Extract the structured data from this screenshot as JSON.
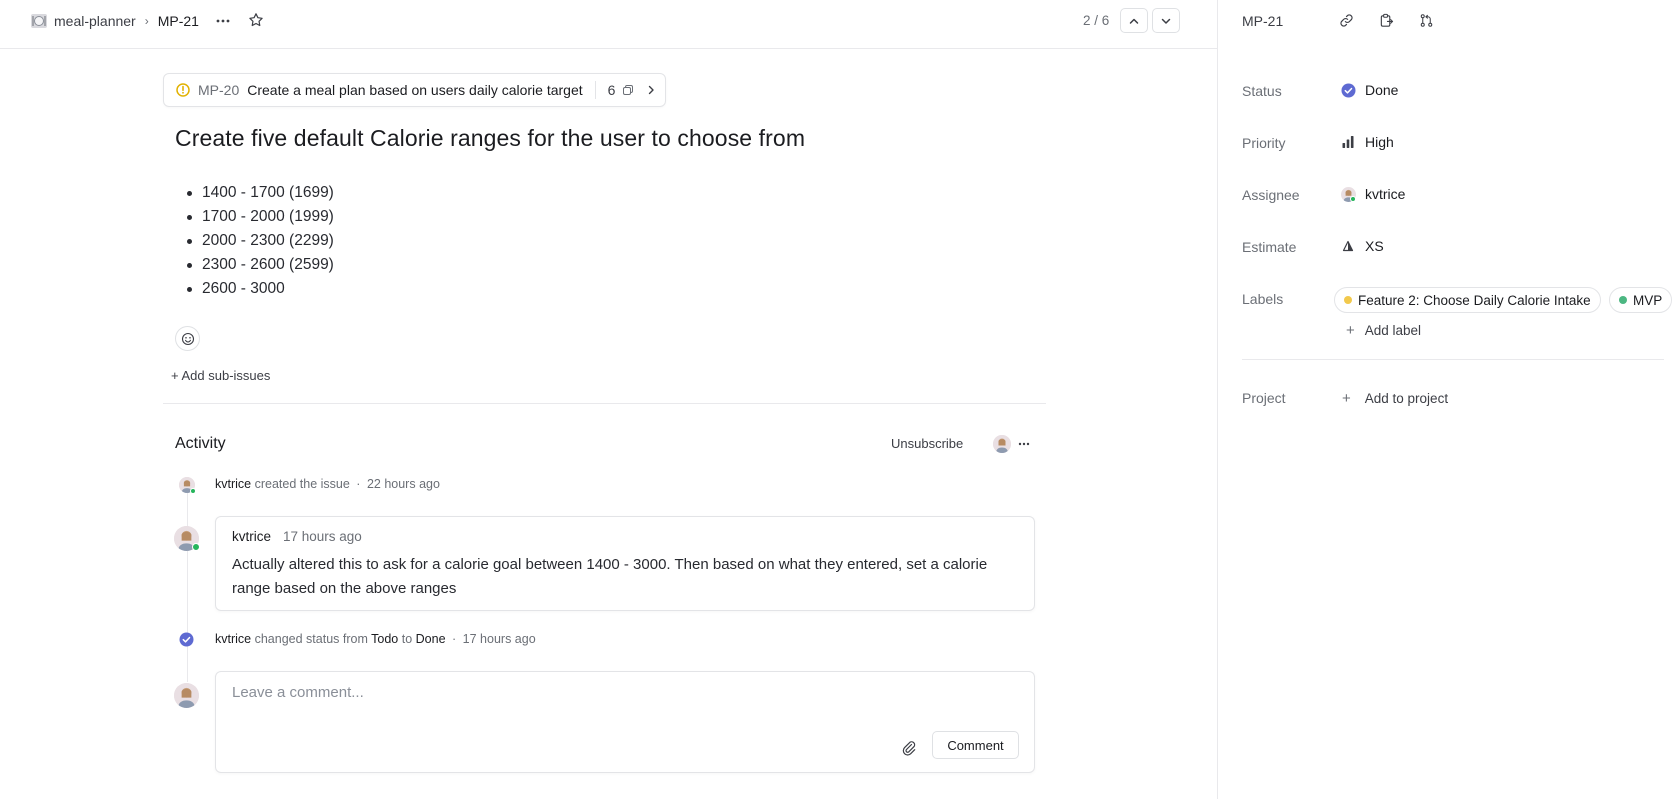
{
  "breadcrumb": {
    "project": "meal-planner",
    "separator": "›",
    "issue": "MP-21"
  },
  "pager": {
    "current": "2",
    "total": "6",
    "text": "2 / 6"
  },
  "parent_issue": {
    "id": "MP-20",
    "title": "Create a meal plan based on users daily calorie target",
    "sub_count": "6"
  },
  "issue": {
    "title": "Create five default Calorie ranges for the user to choose from",
    "description_items": [
      "1400 - 1700 (1699)",
      "1700 - 2000 (1999)",
      "2000 - 2300 (2299)",
      "2300 - 2600 (2599)",
      "2600 - 3000"
    ],
    "add_sub_issues": "+ Add sub-issues"
  },
  "activity": {
    "title": "Activity",
    "unsubscribe": "Unsubscribe",
    "events": [
      {
        "user": "kvtrice",
        "action": "created the issue",
        "dot": "·",
        "time": "22 hours ago"
      },
      {
        "user": "kvtrice",
        "action": "changed status from",
        "from": "Todo",
        "to_word": "to",
        "to": "Done",
        "dot": "·",
        "time": "17 hours ago"
      }
    ],
    "comment": {
      "user": "kvtrice",
      "time": "17 hours ago",
      "body": "Actually altered this to ask for a calorie goal between 1400 - 3000. Then based on what they entered, set a calorie range based on the above ranges"
    },
    "composer": {
      "placeholder": "Leave a comment...",
      "button": "Comment"
    }
  },
  "sidebar": {
    "issue_id": "MP-21",
    "status": {
      "label": "Status",
      "value": "Done",
      "color": "#5e6ad2"
    },
    "priority": {
      "label": "Priority",
      "value": "High"
    },
    "assignee": {
      "label": "Assignee",
      "value": "kvtrice"
    },
    "estimate": {
      "label": "Estimate",
      "value": "XS"
    },
    "labels": {
      "label": "Labels",
      "items": [
        {
          "name": "Feature 2: Choose Daily Calorie Intake",
          "color": "#f2c94c"
        },
        {
          "name": "MVP",
          "color": "#4cb782"
        }
      ],
      "add": "Add label"
    },
    "project": {
      "label": "Project",
      "add": "Add to project"
    }
  },
  "icons": {
    "project": "dish-icon",
    "more": "more-horizontal-icon",
    "favorite": "star-icon",
    "prev": "chevron-up-icon",
    "next": "chevron-down-icon",
    "link": "link-icon",
    "copy_id": "clipboard-icon",
    "branch": "git-branch-icon",
    "emoji": "add-reaction-icon",
    "attach": "paperclip-icon",
    "sub_issues": "copy-icon",
    "parent_status": "in-progress-icon"
  }
}
